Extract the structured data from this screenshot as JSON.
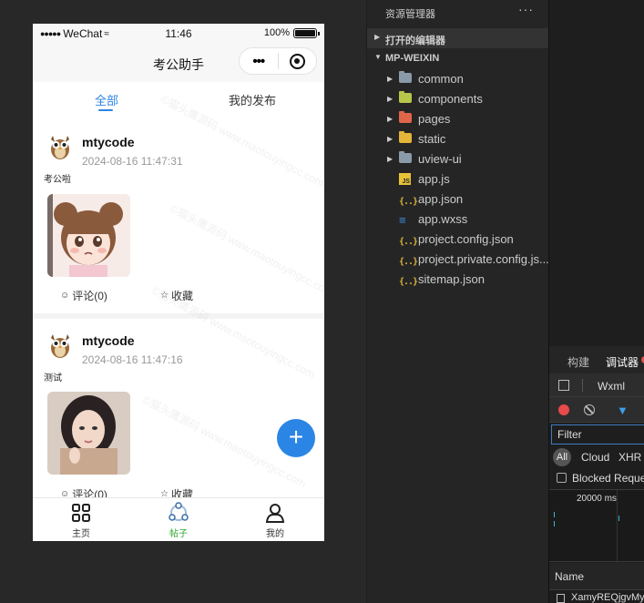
{
  "status_bar": {
    "signal": "●●●●●",
    "carrier": "WeChat",
    "time": "11:46",
    "battery": "100%"
  },
  "navbar": {
    "title": "考公助手",
    "more": "•••"
  },
  "tabs": [
    {
      "label": "全部",
      "active": true
    },
    {
      "label": "我的发布",
      "active": false
    }
  ],
  "posts": [
    {
      "author": "mtycode",
      "time": "2024-08-16 11:47:31",
      "category": "考公啦",
      "comment_label": "评论(0)",
      "favorite_label": "收藏"
    },
    {
      "author": "mtycode",
      "time": "2024-08-16 11:47:16",
      "category": "测试",
      "comment_label": "评论(0)",
      "favorite_label": "收藏"
    }
  ],
  "fab": {
    "label": "+"
  },
  "tabbar": [
    {
      "label": "主页",
      "icon": "grid-icon"
    },
    {
      "label": "帖子",
      "icon": "share-icon",
      "active": true
    },
    {
      "label": "我的",
      "icon": "user-icon"
    }
  ],
  "watermark": "©猫头鹰源码 www.maotouyingcc.com",
  "explorer": {
    "title": "资源管理器",
    "more": "···",
    "section_open_editors": "打开的编辑器",
    "section_project": "MP-WEIXIN",
    "files": [
      {
        "label": "common",
        "type": "folder",
        "icon": "folder-icon"
      },
      {
        "label": "components",
        "type": "folder",
        "icon": "components-folder-icon"
      },
      {
        "label": "pages",
        "type": "folder",
        "icon": "pages-folder-icon"
      },
      {
        "label": "static",
        "type": "folder",
        "icon": "static-folder-icon"
      },
      {
        "label": "uview-ui",
        "type": "folder",
        "icon": "folder-icon"
      },
      {
        "label": "app.js",
        "type": "js",
        "icon": "js-file-icon"
      },
      {
        "label": "app.json",
        "type": "json",
        "icon": "json-file-icon"
      },
      {
        "label": "app.wxss",
        "type": "css",
        "icon": "css-file-icon"
      },
      {
        "label": "project.config.json",
        "type": "json",
        "icon": "json-file-icon"
      },
      {
        "label": "project.private.config.js...",
        "type": "json",
        "icon": "json-file-icon"
      },
      {
        "label": "sitemap.json",
        "type": "json",
        "icon": "json-file-icon"
      }
    ]
  },
  "devtools": {
    "tab_build": "构建",
    "tab_debugger": "调试器",
    "panel": "Wxml",
    "filter_placeholder": "Filter",
    "chip_all": "All",
    "chip_cloud": "Cloud",
    "chip_xhr": "XHR",
    "blocked_label": "Blocked Reque",
    "timeline_label": "20000 ms",
    "name_header": "Name",
    "request_row": "XamyREQjgvMy"
  },
  "colors": {
    "accent": "#2b85e4",
    "tab_active_green": "#2aa52a",
    "ide_bg": "#252526"
  }
}
